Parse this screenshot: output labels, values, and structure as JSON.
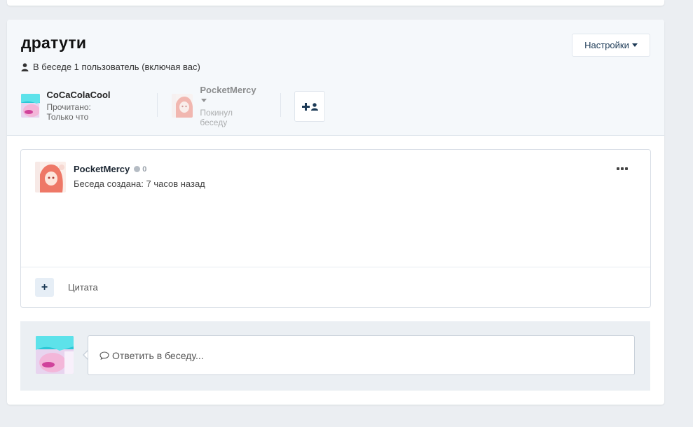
{
  "conversation": {
    "title": "дратути",
    "participants_summary": "В беседе 1 пользователь (включая вас)",
    "settings_label": "Настройки"
  },
  "participants": [
    {
      "name": "CoCaColaCool",
      "status": "Прочитано: Только что",
      "avatar": "cyan-pink-avatar"
    },
    {
      "name": "PocketMercy",
      "status": "Покинул беседу",
      "avatar": "pink-haired-avatar"
    }
  ],
  "message": {
    "author": "PocketMercy",
    "reputation": "0",
    "date": "Беседа создана: 7 часов назад",
    "quote_label": "Цитата"
  },
  "reply": {
    "placeholder": "Ответить в беседу..."
  },
  "colors": {
    "accent": "#1c3a56",
    "header_bg": "#f5f8fb",
    "page_bg": "#ebeef2"
  }
}
